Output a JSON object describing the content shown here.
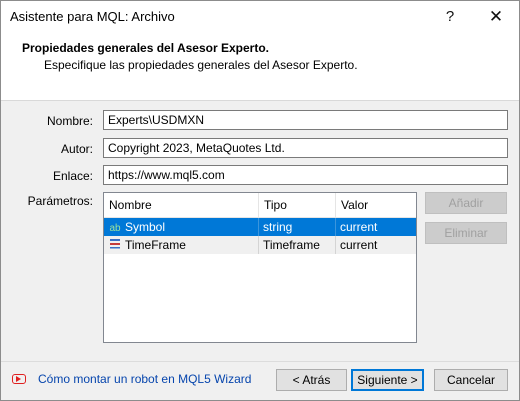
{
  "window": {
    "title": "Asistente para MQL: Archivo",
    "help_glyph": "?",
    "close_glyph": "✕"
  },
  "header": {
    "title": "Propiedades generales del Asesor Experto.",
    "subtitle": "Especifique las propiedades generales del Asesor Experto."
  },
  "form": {
    "name_label": "Nombre:",
    "name_value": "Experts\\USDMXN",
    "author_label": "Autor:",
    "author_value": "Copyright 2023, MetaQuotes Ltd.",
    "link_label": "Enlace:",
    "link_value": "https://www.mql5.com",
    "params_label": "Parámetros:"
  },
  "params_table": {
    "columns": [
      "Nombre",
      "Tipo",
      "Valor"
    ],
    "rows": [
      {
        "icon": "string-param-icon",
        "name": "Symbol",
        "type": "string",
        "value": "current",
        "selected": true
      },
      {
        "icon": "enum-param-icon",
        "name": "TimeFrame",
        "type": "Timeframe",
        "value": "current",
        "selected": false
      }
    ]
  },
  "buttons": {
    "add": "Añadir",
    "remove": "Eliminar",
    "back": "< Atrás",
    "next": "Siguiente >",
    "cancel": "Cancelar"
  },
  "footer": {
    "help_link": "Cómo montar un robot en MQL5 Wizard",
    "help_icon": "youtube-play-icon"
  },
  "colors": {
    "selection": "#0078d7",
    "link": "#0645ad",
    "icon_red": "#e02020"
  }
}
